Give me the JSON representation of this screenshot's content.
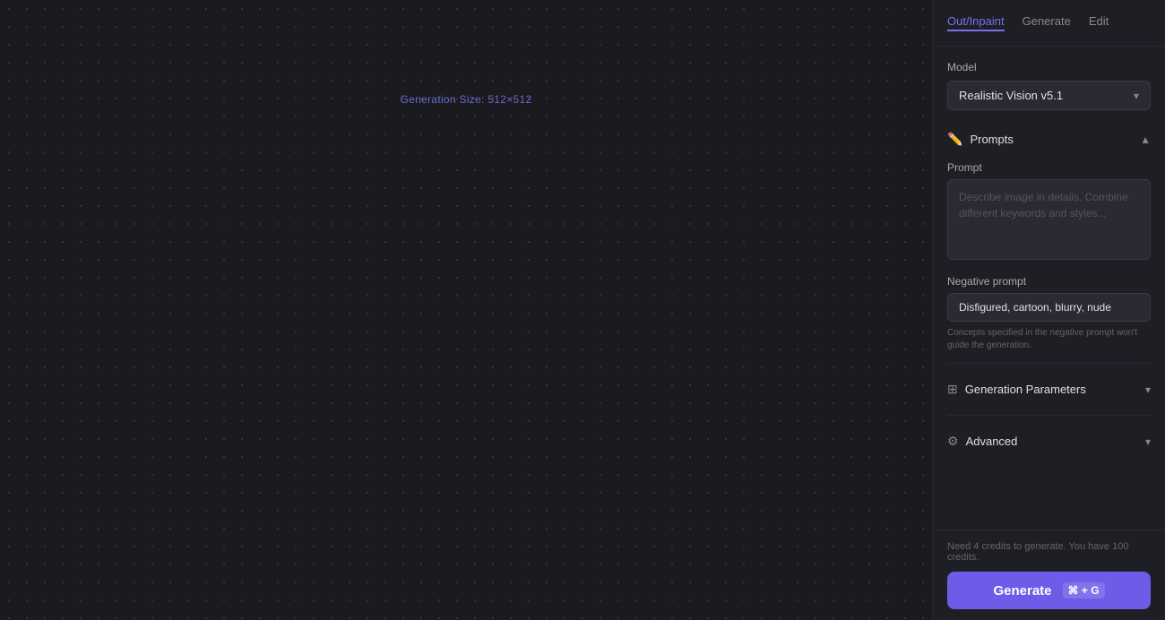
{
  "canvas": {
    "generation_size_label": "Generation Size: 512×512"
  },
  "tabs": [
    {
      "id": "out-inpaint",
      "label": "Out/Inpaint",
      "active": true
    },
    {
      "id": "generate",
      "label": "Generate",
      "active": false
    },
    {
      "id": "edit",
      "label": "Edit",
      "active": false
    }
  ],
  "model_section": {
    "label": "Model",
    "selected_model": "Realistic Vision v5.1"
  },
  "prompts_section": {
    "title": "Prompts",
    "collapsed": false,
    "prompt": {
      "label": "Prompt",
      "placeholder": "Describe image in details. Combine different keywords and styles...",
      "value": ""
    },
    "negative_prompt": {
      "label": "Negative prompt",
      "value": "Disfigured, cartoon, blurry, nude",
      "hint": "Concepts specified in the negative prompt won't guide the generation."
    }
  },
  "generation_parameters_section": {
    "title": "Generation Parameters",
    "collapsed": true
  },
  "advanced_section": {
    "title": "Advanced",
    "collapsed": true
  },
  "bottom_bar": {
    "credits_text": "Need 4 credits to generate. You have 100 credits.",
    "generate_button_label": "Generate",
    "shortcut": "⌘ + G"
  }
}
